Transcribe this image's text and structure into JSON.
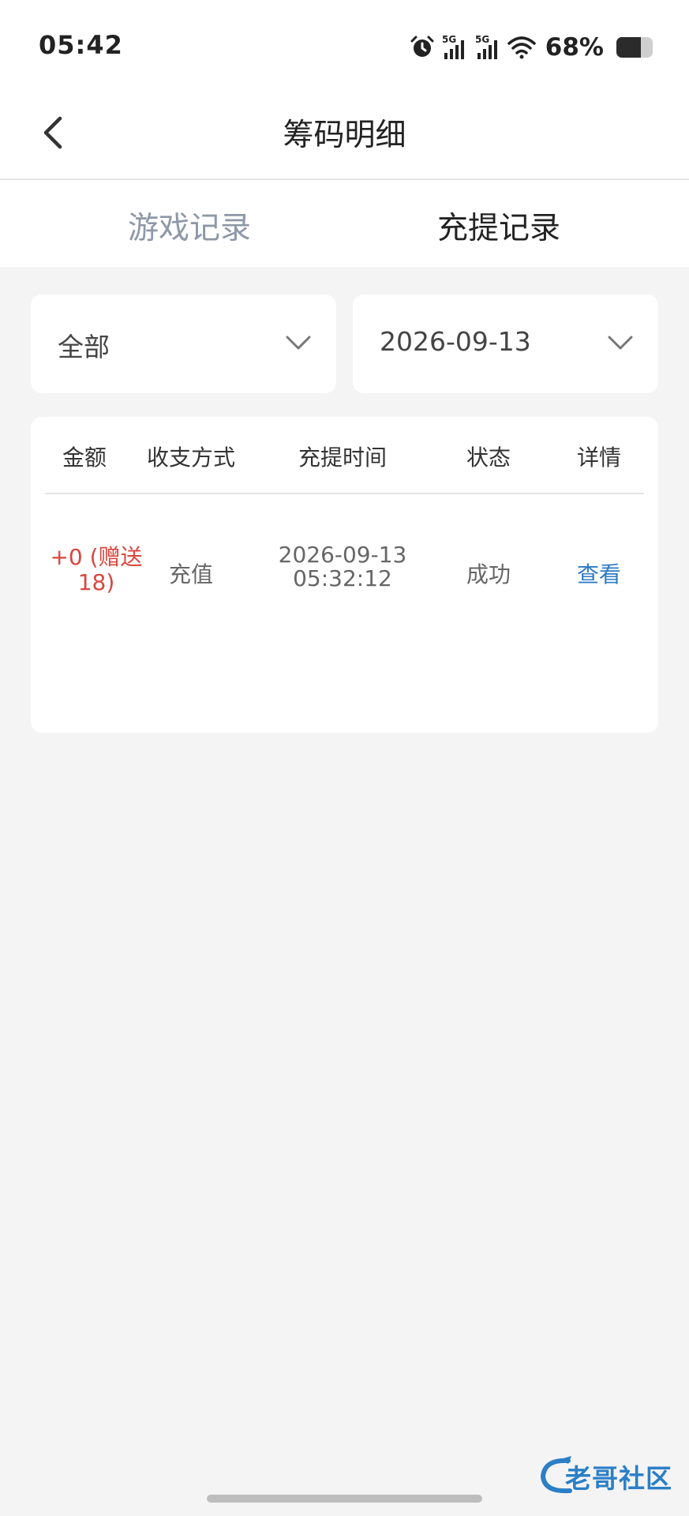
{
  "status_bar": {
    "time": "05:42",
    "network_1": "5G",
    "network_2": "5G",
    "battery_percent_label": "68%",
    "battery_level": 0.68,
    "icons": [
      "alarm-icon",
      "signal-5g-icon",
      "signal-5g-icon",
      "wifi-icon",
      "battery-icon"
    ]
  },
  "header": {
    "title": "筹码明细"
  },
  "tabs": [
    {
      "label": "游戏记录",
      "active": false
    },
    {
      "label": "充提记录",
      "active": true
    }
  ],
  "filters": {
    "type": {
      "value": "全部"
    },
    "date": {
      "value": "2026-09-13"
    }
  },
  "table": {
    "columns": [
      "金额",
      "收支方式",
      "充提时间",
      "状态",
      "详情"
    ],
    "rows": [
      {
        "amount_line1": "+0 (赠送",
        "amount_line2": "18)",
        "method": "充值",
        "date": "2026-09-13",
        "time": "05:32:12",
        "status": "成功",
        "detail": "查看"
      }
    ]
  },
  "colors": {
    "accent_link": "#2f7bc4",
    "amount_red": "#d9463e",
    "inactive_tab": "#8e98a8",
    "background": "#f4f4f4"
  },
  "watermark": {
    "text": "老哥社区"
  }
}
